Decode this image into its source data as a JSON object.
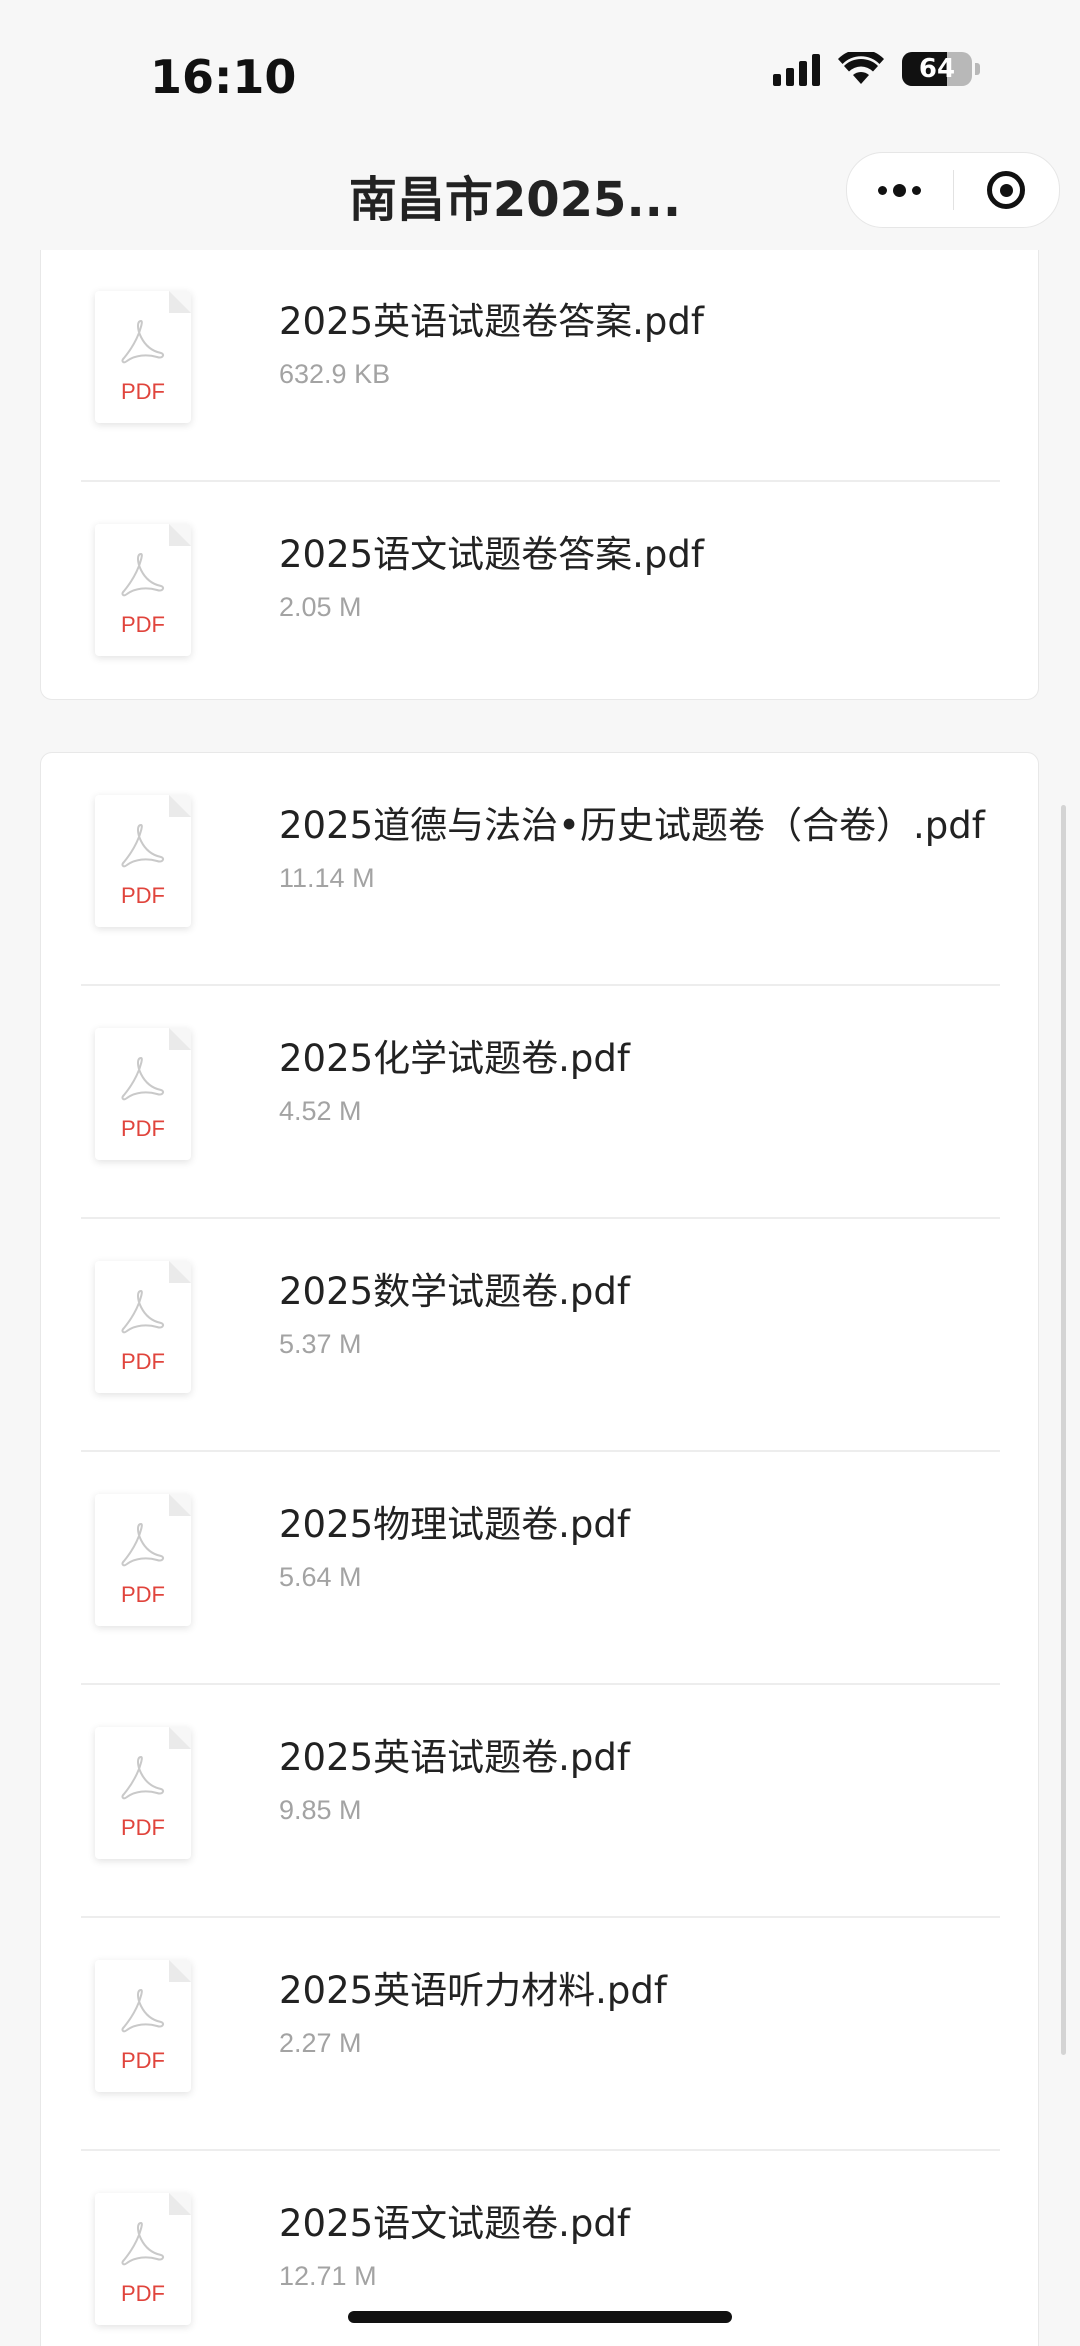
{
  "status_bar": {
    "time": "16:10",
    "battery_level": "64",
    "icons": [
      "signal-icon",
      "wifi-icon",
      "battery-icon"
    ]
  },
  "nav": {
    "title": "南昌市2025...",
    "icons": [
      "more-icon",
      "close-target-icon"
    ]
  },
  "file_icon": {
    "label": "PDF",
    "icon": "pdf-file-icon",
    "accent_color": "#e0443c"
  },
  "groups": [
    {
      "files": [
        {
          "name": "2025英语试题卷答案.pdf",
          "size": "632.9 KB"
        },
        {
          "name": "2025语文试题卷答案.pdf",
          "size": "2.05 M"
        }
      ]
    },
    {
      "files": [
        {
          "name": "2025道德与法治•历史试题卷（合卷）.pdf",
          "size": "11.14 M"
        },
        {
          "name": "2025化学试题卷.pdf",
          "size": "4.52 M"
        },
        {
          "name": "2025数学试题卷.pdf",
          "size": "5.37 M"
        },
        {
          "name": "2025物理试题卷.pdf",
          "size": "5.64 M"
        },
        {
          "name": "2025英语试题卷.pdf",
          "size": "9.85 M"
        },
        {
          "name": "2025英语听力材料.pdf",
          "size": "2.27 M"
        },
        {
          "name": "2025语文试题卷.pdf",
          "size": "12.71 M"
        }
      ]
    }
  ]
}
